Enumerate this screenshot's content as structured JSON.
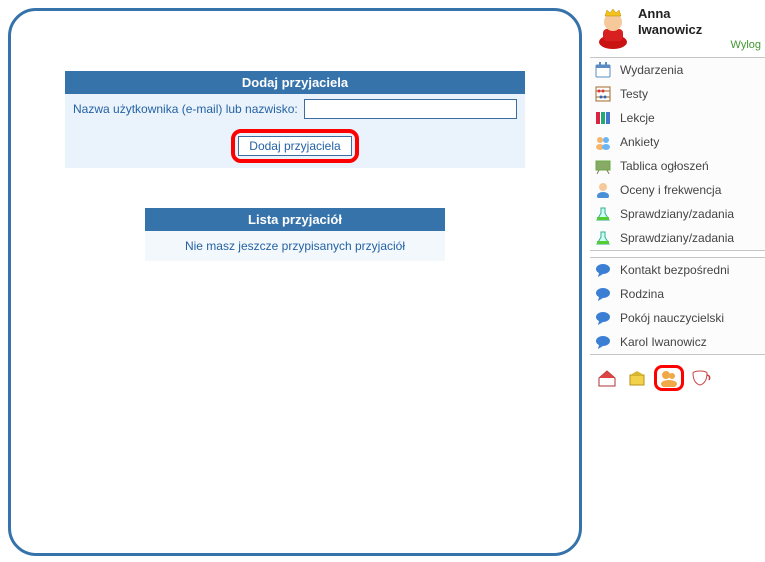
{
  "main": {
    "addFriend": {
      "title": "Dodaj przyjaciela",
      "label": "Nazwa użytkownika (e-mail) lub nazwisko:",
      "button": "Dodaj przyjaciela"
    },
    "friendList": {
      "title": "Lista przyjaciół",
      "empty": "Nie masz jeszcze przypisanych przyjaciół"
    }
  },
  "sidebar": {
    "user": {
      "name1": "Anna",
      "name2": "Iwanowicz",
      "logout": "Wylog"
    },
    "menu1": [
      {
        "label": "Wydarzenia"
      },
      {
        "label": "Testy"
      },
      {
        "label": "Lekcje"
      },
      {
        "label": "Ankiety"
      },
      {
        "label": "Tablica ogłoszeń"
      },
      {
        "label": "Oceny i frekwencja"
      },
      {
        "label": "Sprawdziany/zadania"
      },
      {
        "label": "Sprawdziany/zadania"
      }
    ],
    "menu2": [
      {
        "label": "Kontakt bezpośredni"
      },
      {
        "label": "Rodzina"
      },
      {
        "label": "Pokój nauczycielski"
      },
      {
        "label": "Karol Iwanowicz"
      }
    ]
  }
}
